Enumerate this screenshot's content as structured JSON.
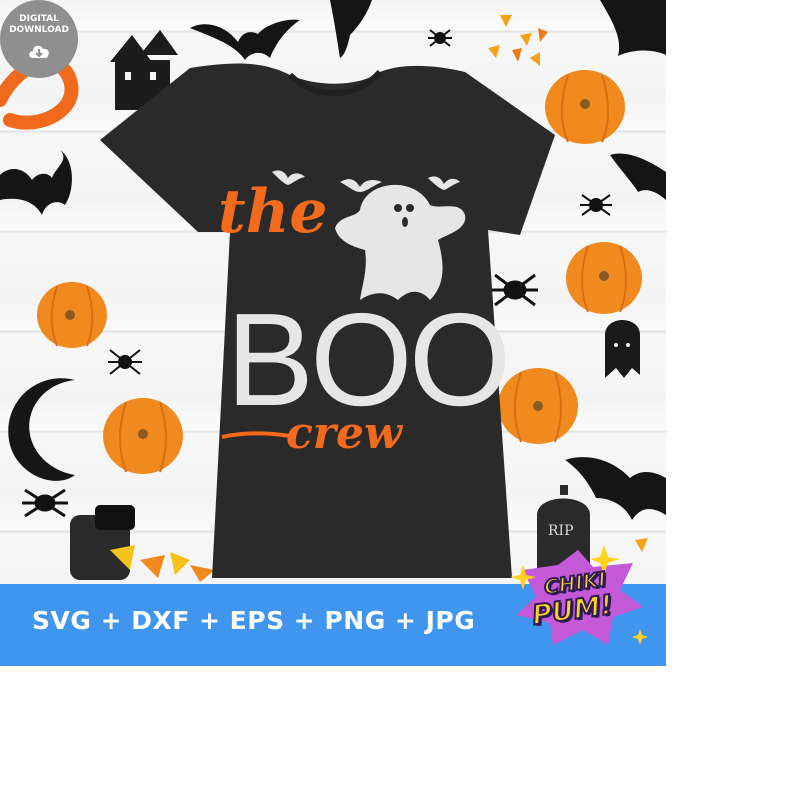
{
  "badge": {
    "line1": "DIGITAL",
    "line2": "DOWNLOAD",
    "icon": "cloud-download-icon"
  },
  "design": {
    "word_top": "the",
    "word_main": "BOO",
    "word_bottom": "crew"
  },
  "banner": {
    "formats": "SVG + DXF + EPS + PNG + JPG"
  },
  "logo": {
    "word1": "CHIKI",
    "word2": "PUM!"
  },
  "tombstone": {
    "text": "RIP"
  },
  "colors": {
    "shirt": "#2b2a2b",
    "orange": "#f26a1b",
    "ghost": "#e6e6e6",
    "banner": "#4096ee",
    "logo_yellow": "#ffd21d"
  }
}
